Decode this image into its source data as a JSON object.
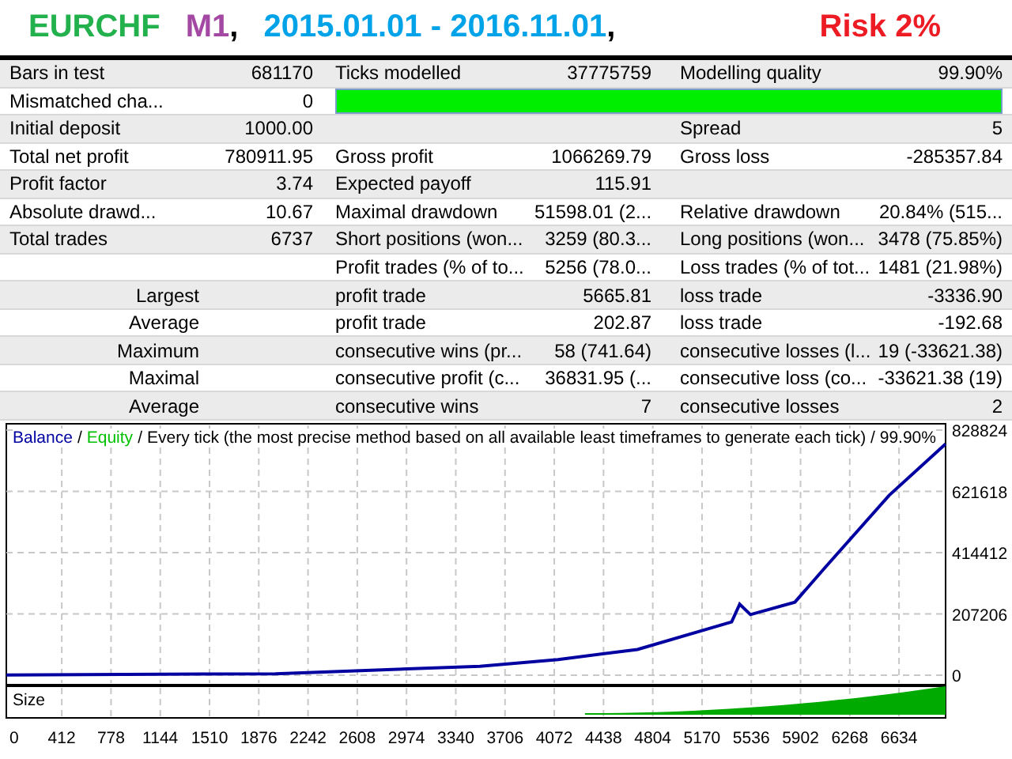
{
  "title": [
    {
      "kind": "label",
      "text": "EURCHF",
      "color": "#22b14c"
    },
    {
      "kind": "label",
      "text": "M1",
      "color": "#a349a4"
    },
    {
      "kind": "punct",
      "text": ","
    },
    {
      "kind": "label",
      "text": "2015.01.01 - 2016.11.01",
      "color": "#00a2e8"
    },
    {
      "kind": "punct",
      "text": ","
    },
    {
      "kind": "flag",
      "text": "Risk 2%",
      "color": "#ed1c24"
    }
  ],
  "report": {
    "rows": [
      {
        "kind": "pair",
        "cells": [
          {
            "label": "Bars in test",
            "value": "681170"
          },
          {
            "label": "Ticks modelled",
            "value": "37775759"
          },
          {
            "label": "Modelling quality",
            "value": "99.90%"
          }
        ]
      },
      {
        "kind": "bar",
        "cells": [
          {
            "label": "Mismatched cha...",
            "value": "0"
          }
        ],
        "level": 1
      },
      {
        "kind": "pair",
        "cells": [
          {
            "label": "Initial deposit",
            "value": "1000.00"
          },
          null,
          {
            "label": "Spread",
            "value": "5"
          }
        ]
      },
      {
        "kind": "pair",
        "cells": [
          {
            "label": "Total net profit",
            "value": "780911.95"
          },
          {
            "label": "Gross profit",
            "value": "1066269.79"
          },
          {
            "label": "Gross loss",
            "value": "-285357.84"
          }
        ]
      },
      {
        "kind": "pair",
        "cells": [
          {
            "label": "Profit factor",
            "value": "3.74"
          },
          {
            "label": "Expected payoff",
            "value": "115.91"
          }
        ]
      },
      {
        "kind": "pair",
        "cells": [
          {
            "label": "Absolute drawd...",
            "value": "10.67"
          },
          {
            "label": "Maximal drawdown",
            "value": "51598.01 (2..."
          },
          {
            "label": "Relative drawdown",
            "value": "20.84% (515..."
          }
        ]
      },
      {
        "kind": "pair",
        "cells": [
          {
            "label": "Total trades",
            "value": "6737"
          },
          {
            "label": "Short positions (won...",
            "value": "3259 (80.3..."
          },
          {
            "label": "Long positions (won...",
            "value": "3478 (75.85%)"
          }
        ]
      },
      {
        "kind": "pair",
        "cells": [
          null,
          {
            "label": "Profit trades (% of to...",
            "value": "5256 (78.0..."
          },
          {
            "label": "Loss trades (% of tot...",
            "value": "1481 (21.98%)"
          }
        ]
      },
      {
        "kind": "group",
        "cells": [
          {
            "label": "Largest"
          },
          {
            "label": "profit trade",
            "value": "5665.81"
          },
          {
            "label": "loss trade",
            "value": "-3336.90"
          }
        ]
      },
      {
        "kind": "group",
        "cells": [
          {
            "label": "Average"
          },
          {
            "label": "profit trade",
            "value": "202.87"
          },
          {
            "label": "loss trade",
            "value": "-192.68"
          }
        ]
      },
      {
        "kind": "group",
        "cells": [
          {
            "label": "Maximum"
          },
          {
            "label": "consecutive wins (pr...",
            "value": "58 (741.64)"
          },
          {
            "label": "consecutive losses (l...",
            "value": "19 (-33621.38)"
          }
        ]
      },
      {
        "kind": "group",
        "cells": [
          {
            "label": "Maximal"
          },
          {
            "label": "consecutive profit (c...",
            "value": "36831.95 (..."
          },
          {
            "label": "consecutive loss (co...",
            "value": "-33621.38 (19)"
          }
        ]
      },
      {
        "kind": "group",
        "cells": [
          {
            "label": "Average"
          },
          {
            "label": "consecutive wins",
            "value": "7"
          },
          {
            "label": "consecutive losses",
            "value": "2"
          }
        ]
      }
    ]
  },
  "chart": {
    "subpanel_label": "Size",
    "legend": [
      {
        "text": "/"
      },
      {
        "text": "Equity",
        "color": "#00c000"
      },
      {
        "text": "/"
      }
    ],
    "chart_data": {
      "type": "line",
      "grid": true,
      "title": "Every tick (the most precise method based on all available least timeframes to generate each tick) / 99.90%",
      "x": [
        0,
        2000,
        3520,
        4100,
        4690,
        5390,
        5450,
        5530,
        5860,
        6090,
        6560,
        6980
      ],
      "series": [
        {
          "name": "Balance",
          "color": "#0000a0",
          "values": [
            1000,
            5000,
            30000,
            53000,
            87000,
            180000,
            240000,
            205000,
            247000,
            367000,
            608000,
            782000
          ]
        }
      ],
      "xlim": [
        0,
        6980
      ],
      "ylim": [
        0,
        828824
      ],
      "xticks": [
        0,
        412,
        778,
        1144,
        1510,
        1876,
        2242,
        2608,
        2974,
        3340,
        3706,
        4072,
        4438,
        4804,
        5170,
        5536,
        5902,
        6268,
        6634
      ],
      "yticks": [
        0,
        207206,
        414412,
        621618,
        828824
      ]
    }
  }
}
